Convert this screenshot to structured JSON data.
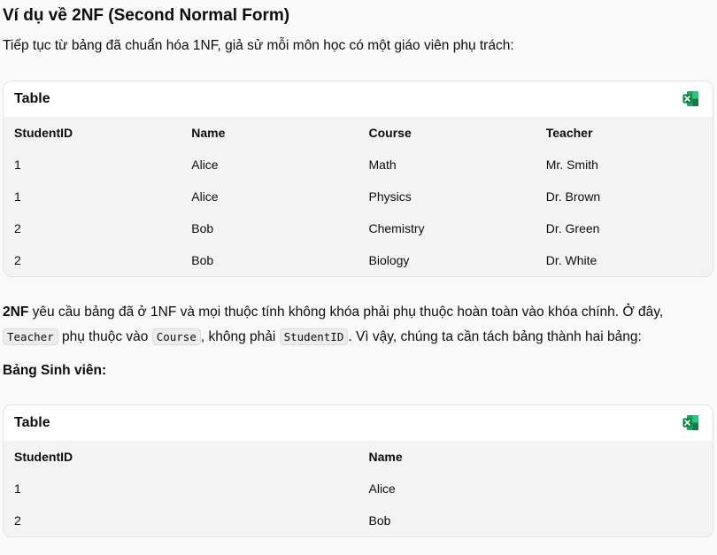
{
  "heading": "Ví dụ về 2NF (Second Normal Form)",
  "intro": "Tiếp tục từ bảng đã chuẩn hóa 1NF, giả sử mỗi môn học có một giáo viên phụ trách:",
  "table1": {
    "title": "Table",
    "icon": "excel-icon",
    "headers": [
      "StudentID",
      "Name",
      "Course",
      "Teacher"
    ],
    "rows": [
      [
        "1",
        "Alice",
        "Math",
        "Mr. Smith"
      ],
      [
        "1",
        "Alice",
        "Physics",
        "Dr. Brown"
      ],
      [
        "2",
        "Bob",
        "Chemistry",
        "Dr. Green"
      ],
      [
        "2",
        "Bob",
        "Biology",
        "Dr. White"
      ]
    ]
  },
  "paragraph": {
    "bold": "2NF",
    "part1": " yêu cầu bảng đã ở 1NF và mọi thuộc tính không khóa phải phụ thuộc hoàn toàn vào khóa chính. Ở đây, ",
    "code1": "Teacher",
    "part2": " phụ thuộc vào ",
    "code2": "Course",
    "part3": ", không phải ",
    "code3": "StudentID",
    "part4": ". Vì vậy, chúng ta cần tách bảng thành hai bảng:"
  },
  "subheading": "Bảng Sinh viên:",
  "table2": {
    "title": "Table",
    "icon": "excel-icon",
    "headers": [
      "StudentID",
      "Name"
    ],
    "rows": [
      [
        "1",
        "Alice"
      ],
      [
        "2",
        "Bob"
      ]
    ]
  },
  "colors": {
    "excel_green": "#1d6f42",
    "table_bg": "#f3f3f3",
    "page_bg": "#f9f9f9"
  }
}
